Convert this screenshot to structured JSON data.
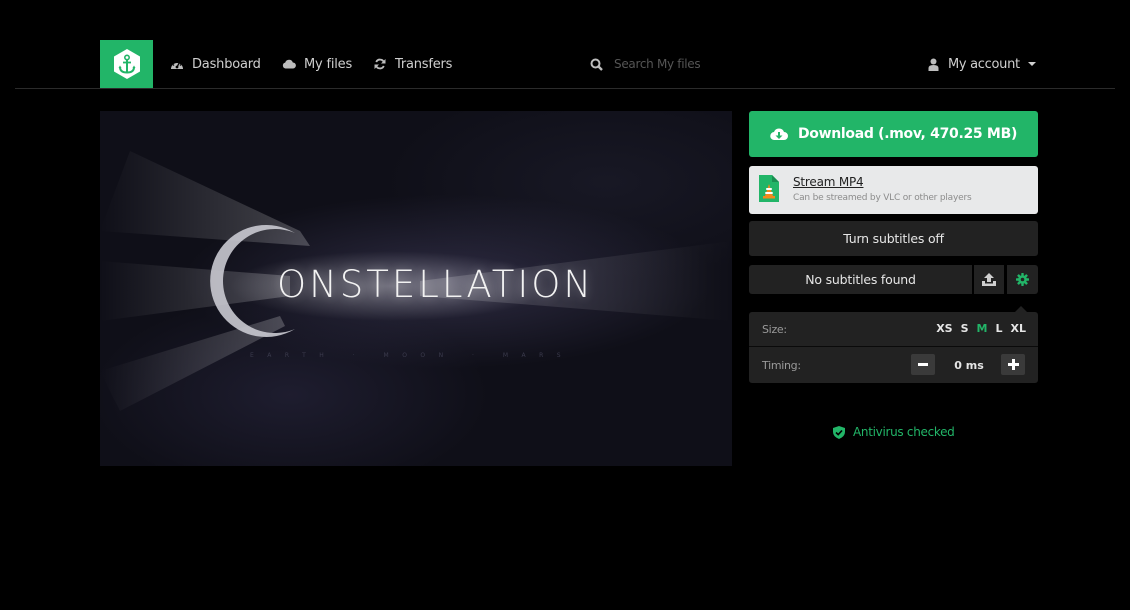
{
  "brand": {
    "logo_icon": "anchor-icon",
    "accent_color": "#22b568"
  },
  "nav": {
    "items": [
      {
        "label": "Dashboard",
        "icon": "dashboard-gauge-icon"
      },
      {
        "label": "My files",
        "icon": "cloud-icon"
      },
      {
        "label": "Transfers",
        "icon": "refresh-icon"
      }
    ]
  },
  "search": {
    "placeholder": "Search My files",
    "value": "",
    "icon": "search-icon"
  },
  "account": {
    "label": "My account",
    "icon": "user-icon",
    "caret": "caret-down-icon"
  },
  "video": {
    "title_text": "ONSTELLATION",
    "subtitle_text": "EARTH · MOON · MARS"
  },
  "download": {
    "label": "Download (.mov, 470.25 MB)",
    "icon": "cloud-download-icon"
  },
  "stream": {
    "title": "Stream MP4",
    "description": "Can be streamed by VLC or other players",
    "icon": "vlc-file-icon"
  },
  "subtitles": {
    "toggle_label": "Turn subtitles off",
    "status_label": "No subtitles found",
    "upload_icon": "upload-icon",
    "settings_icon": "gear-icon"
  },
  "subtitle_settings": {
    "size_label": "Size:",
    "sizes": [
      "XS",
      "S",
      "M",
      "L",
      "XL"
    ],
    "selected_size": "M",
    "timing_label": "Timing:",
    "timing_value": "0 ms"
  },
  "antivirus": {
    "label": "Antivirus checked",
    "icon": "shield-check-icon"
  }
}
